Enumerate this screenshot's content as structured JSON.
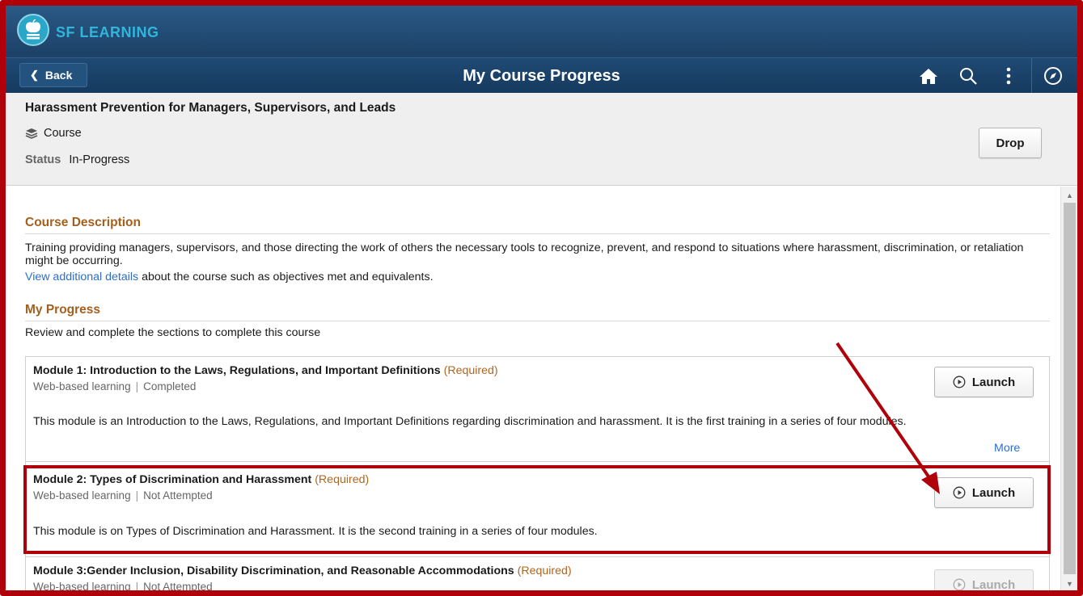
{
  "brand": {
    "name": "SF LEARNING"
  },
  "nav": {
    "back_label": "Back",
    "title": "My Course Progress",
    "icons": [
      "home-icon",
      "search-icon",
      "more-vertical-icon",
      "compass-icon"
    ]
  },
  "course": {
    "title": "Harassment Prevention for Managers, Supervisors, and Leads",
    "type": "Course",
    "status_label": "Status",
    "status_value": "In-Progress",
    "drop_label": "Drop"
  },
  "description": {
    "heading": "Course Description",
    "text": "Training providing managers, supervisors, and those directing the work of others the necessary tools to recognize, prevent, and respond to situations where harassment, discrimination, or retaliation might be occurring.",
    "link_text": "View additional details",
    "link_suffix": " about the course such as objectives met and equivalents."
  },
  "progress": {
    "heading": "My Progress",
    "intro": "Review and complete the sections to complete this course",
    "required_label": "(Required)",
    "launch_label": "Launch",
    "more_label": "More",
    "modules": [
      {
        "title": "Module 1: Introduction to the Laws, Regulations, and Important Definitions",
        "method": "Web-based learning",
        "status": "Completed",
        "description": "This module is an Introduction to the Laws, Regulations, and Important Definitions regarding discrimination and harassment. It is the first training in a series of four modules."
      },
      {
        "title": "Module 2: Types of Discrimination and Harassment",
        "method": "Web-based learning",
        "status": "Not Attempted",
        "description": "This module is on Types of Discrimination and Harassment. It is the second training in a series of four modules."
      },
      {
        "title": "Module 3:Gender Inclusion, Disability Discrimination, and Reasonable Accommodations",
        "method": "Web-based learning",
        "status": "Not Attempted",
        "launch_disabled": true
      }
    ]
  },
  "colors": {
    "accent": "#a45f1d",
    "link": "#2a6fcf",
    "annotation": "#b0000a",
    "header": "#1c4066"
  }
}
